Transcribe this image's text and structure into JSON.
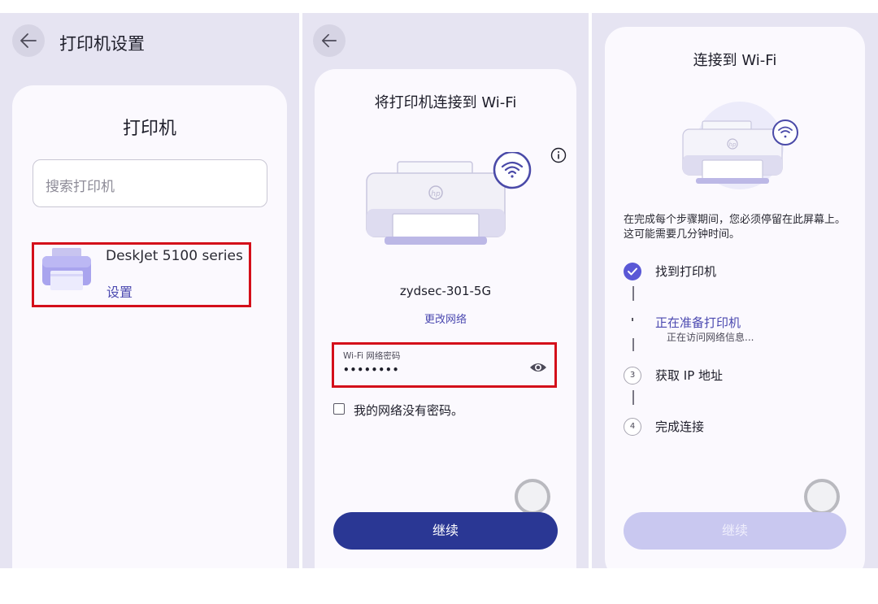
{
  "panel1": {
    "header_title": "打印机设置",
    "card_title": "打印机",
    "search_placeholder": "搜索打印机",
    "printer": {
      "name": "DeskJet 5100 series",
      "setup_label": "设置"
    }
  },
  "panel2": {
    "card_title": "将打印机连接到 Wi-Fi",
    "ssid": "zydsec-301-5G",
    "change_network": "更改网络",
    "password_label": "Wi-Fi 网络密码",
    "password_value": "••••••••",
    "no_password_label": "我的网络没有密码。",
    "continue_label": "继续"
  },
  "panel3": {
    "card_title": "连接到 Wi-Fi",
    "note": "在完成每个步骤期间，您必须停留在此屏幕上。这可能需要几分钟时间。",
    "steps": [
      {
        "label": "找到打印机",
        "status": "done"
      },
      {
        "label": "正在准备打印机",
        "sub": "正在访问网络信息...",
        "status": "active"
      },
      {
        "number": "3",
        "label": "获取 IP 地址",
        "status": "pending"
      },
      {
        "number": "4",
        "label": "完成连接",
        "status": "pending"
      }
    ],
    "continue_label": "继续"
  },
  "colors": {
    "panel_bg": "#e6e4f2",
    "card_bg": "#fbf9fe",
    "accent_blue": "#4b49b0",
    "button_dark": "#2a3794",
    "button_disabled": "#c9c8f0",
    "highlight_red": "#d40f1a"
  }
}
